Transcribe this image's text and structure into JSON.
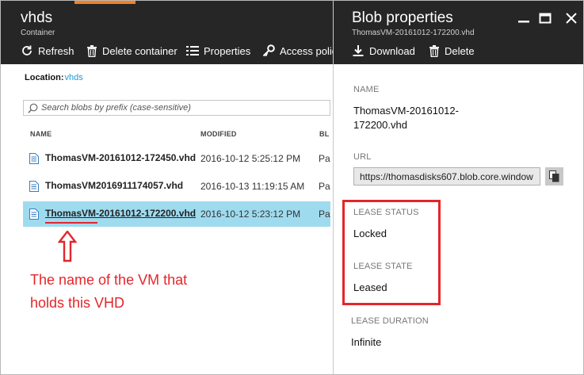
{
  "left_blade": {
    "title": "vhds",
    "subtitle": "Container",
    "toolbar": {
      "refresh": "Refresh",
      "delete_container": "Delete container",
      "properties": "Properties",
      "access_policy": "Access polic"
    },
    "location_label": "Location:",
    "location_value": "vhds",
    "search_placeholder": "Search blobs by prefix (case-sensitive)",
    "columns": {
      "name": "NAME",
      "modified": "MODIFIED",
      "extra": "BL"
    },
    "rows": [
      {
        "name": "ThomasVM-20161012-172450.vhd",
        "modified": "2016-10-12 5:25:12 PM",
        "extra": "Pa"
      },
      {
        "name": "ThomasVM2016911174057.vhd",
        "modified": "2016-10-13 11:19:15 AM",
        "extra": "Pa"
      },
      {
        "name": "ThomasVM-20161012-172200.vhd",
        "modified": "2016-10-12 5:23:12 PM",
        "extra": "Pa"
      }
    ]
  },
  "annotation": {
    "line1": "The name of the VM that",
    "line2": "holds this VHD",
    "color": "#e3262b"
  },
  "right_blade": {
    "title": "Blob properties",
    "subtitle": "ThomasVM-20161012-172200.vhd",
    "toolbar": {
      "download": "Download",
      "delete": "Delete"
    },
    "name_label": "NAME",
    "name_line1": "ThomasVM-20161012-",
    "name_line2": "172200.vhd",
    "url_label": "URL",
    "url_value": "https://thomasdisks607.blob.core.window",
    "lease_status_label": "LEASE STATUS",
    "lease_status_value": "Locked",
    "lease_state_label": "LEASE STATE",
    "lease_state_value": "Leased",
    "lease_duration_label": "LEASE DURATION",
    "lease_duration_value": "Infinite"
  },
  "colors": {
    "header_bg": "#262626",
    "accent_orange": "#f48024",
    "selected_row": "#9fdbef",
    "link": "#1a9bd7"
  }
}
